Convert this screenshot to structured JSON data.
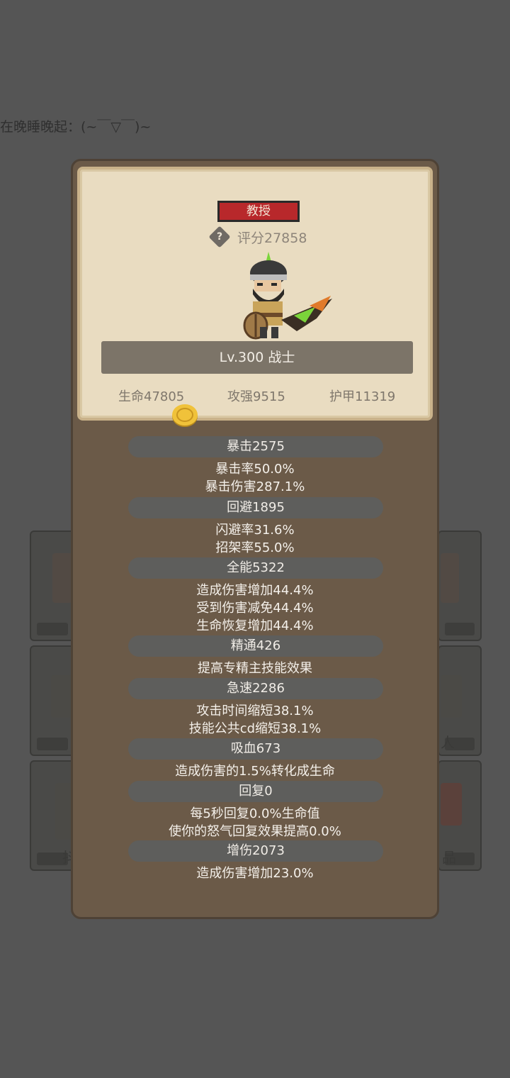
{
  "marquee": "在晚睡晚起：(~￣▽￣)~",
  "background": {
    "tiles_left_labels": [
      "",
      "",
      "抖"
    ],
    "tiles_right_labels": [
      "",
      "人",
      "品"
    ]
  },
  "panel": {
    "title": "教授",
    "score": "评分27858",
    "help_glyph": "?",
    "level_class": "Lv.300 战士",
    "stats": {
      "hp": "生命47805",
      "atk": "攻强9515",
      "armor": "护甲11319"
    }
  },
  "attributes": [
    {
      "name": "暴击2575",
      "lines": [
        "暴击率50.0%",
        "暴击伤害287.1%"
      ]
    },
    {
      "name": "回避1895",
      "lines": [
        "闪避率31.6%",
        "招架率55.0%"
      ]
    },
    {
      "name": "全能5322",
      "lines": [
        "造成伤害增加44.4%",
        "受到伤害减免44.4%",
        "生命恢复增加44.4%"
      ]
    },
    {
      "name": "精通426",
      "lines": [
        "提高专精主技能效果"
      ]
    },
    {
      "name": "急速2286",
      "lines": [
        "攻击时间缩短38.1%",
        "技能公共cd缩短38.1%"
      ]
    },
    {
      "name": "吸血673",
      "lines": [
        "造成伤害的1.5%转化成生命"
      ]
    },
    {
      "name": "回复0",
      "lines": [
        "每5秒回复0.0%生命值",
        "使你的怒气回复效果提高0.0%"
      ]
    },
    {
      "name": "增伤2073",
      "lines": [
        "造成伤害增加23.0%"
      ]
    }
  ]
}
